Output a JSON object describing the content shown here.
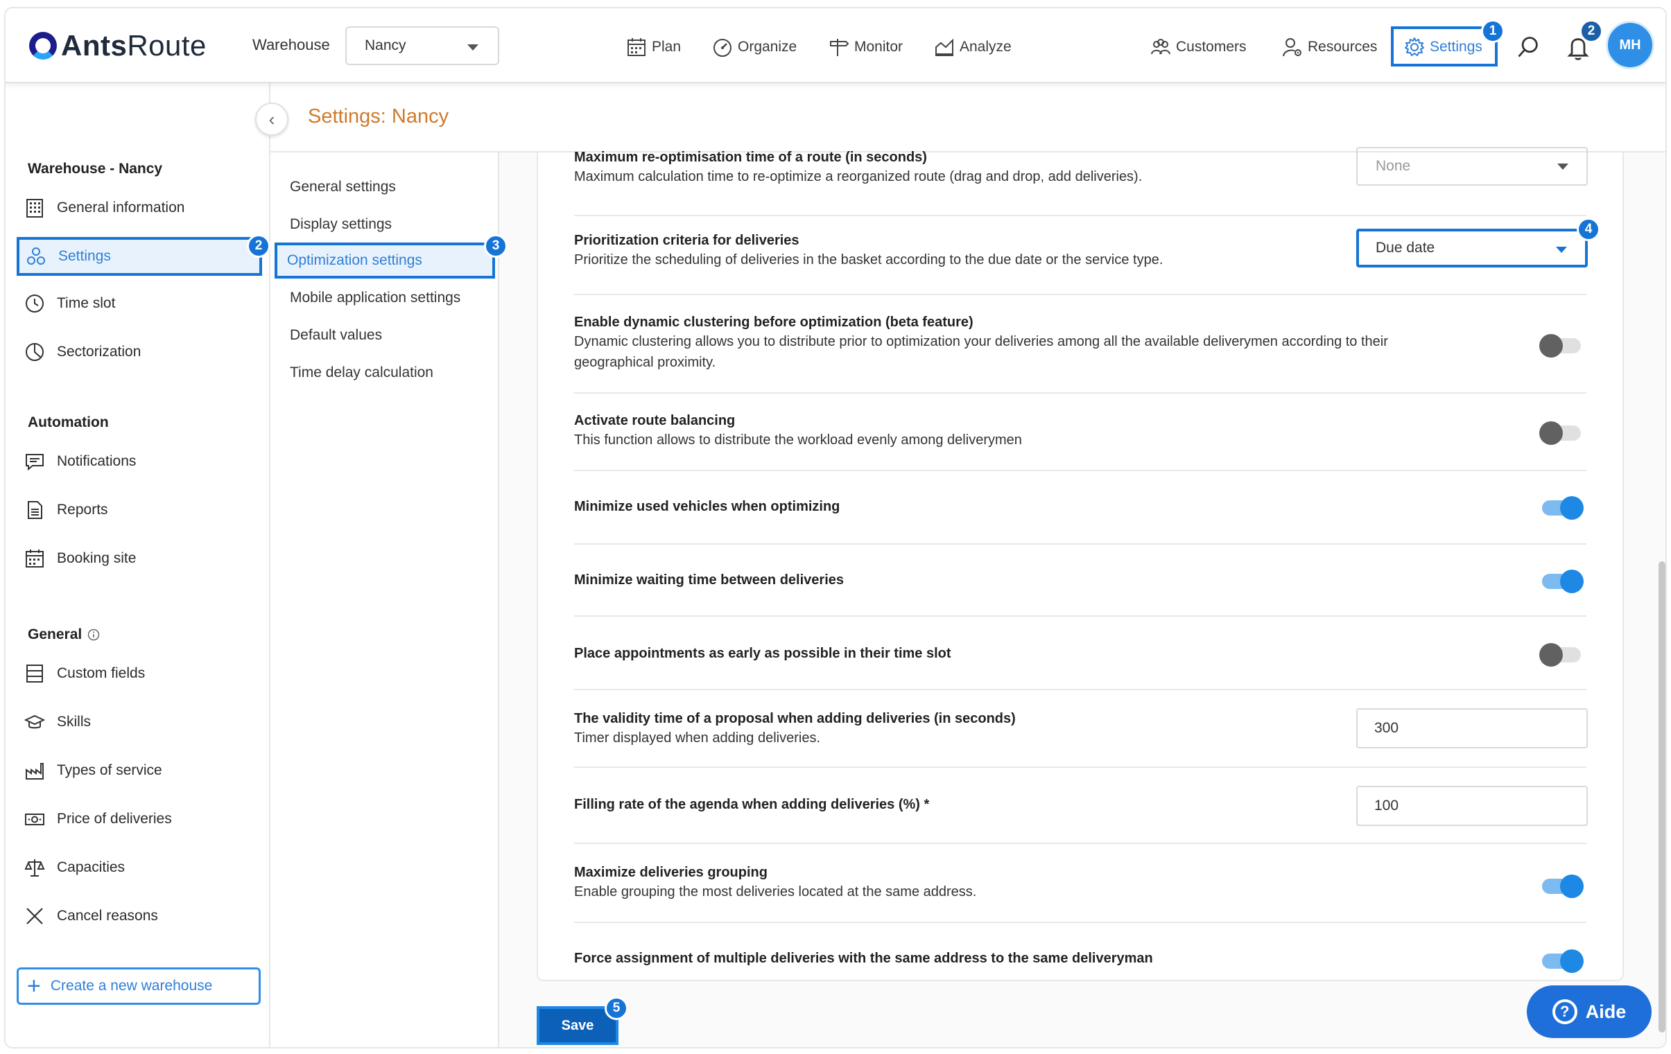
{
  "app": {
    "logo_bold": "Ants",
    "logo_rest": "Route",
    "warehouse_label": "Warehouse",
    "warehouse_value": "Nancy"
  },
  "nav": {
    "plan": "Plan",
    "organize": "Organize",
    "monitor": "Monitor",
    "analyze": "Analyze",
    "customers": "Customers",
    "resources": "Resources",
    "settings": "Settings",
    "notification_count": "2",
    "avatar_initials": "MH"
  },
  "steps": [
    "1",
    "2",
    "3",
    "4",
    "5"
  ],
  "sidebar": {
    "section_warehouse": "Warehouse - Nancy",
    "warehouse_items": [
      "General information",
      "Settings",
      "Time slot",
      "Sectorization"
    ],
    "section_automation": "Automation",
    "automation_items": [
      "Notifications",
      "Reports",
      "Booking site"
    ],
    "section_general": "General",
    "general_items": [
      "Custom fields",
      "Skills",
      "Types of service",
      "Price of deliveries",
      "Capacities",
      "Cancel reasons"
    ],
    "create_button": "Create a new warehouse"
  },
  "page": {
    "title": "Settings: Nancy"
  },
  "submenu": [
    "General settings",
    "Display settings",
    "Optimization settings",
    "Mobile application settings",
    "Default values",
    "Time delay calculation"
  ],
  "settings": {
    "reopt_title": "Maximum re-optimisation time of a route (in seconds)",
    "reopt_desc": "Maximum calculation time to re-optimize a reorganized route (drag and drop, add deliveries).",
    "reopt_value": "None",
    "prio_title": "Prioritization criteria for deliveries",
    "prio_desc": "Prioritize the scheduling of deliveries in the basket according to the due date or the service type.",
    "prio_value": "Due date",
    "cluster_title": "Enable dynamic clustering before optimization (beta feature)",
    "cluster_desc_1": "Dynamic clustering allows you to distribute prior to optimization your deliveries among all the available deliverymen according to their",
    "cluster_desc_2": "geographical proximity.",
    "balance_title": "Activate route balancing",
    "balance_desc": "This function allows to distribute the workload evenly among deliverymen",
    "min_vehicles_title": "Minimize used vehicles when optimizing",
    "min_waiting_title": "Minimize waiting time between deliveries",
    "early_title": "Place appointments as early as possible in their time slot",
    "validity_title": "The validity time of a proposal when adding deliveries (in seconds)",
    "validity_desc": "Timer displayed when adding deliveries.",
    "validity_value": "300",
    "filling_title": "Filling rate of the agenda when adding deliveries (%) *",
    "filling_value": "100",
    "grouping_title": "Maximize deliveries grouping",
    "grouping_desc": "Enable grouping the most deliveries located at the same address.",
    "force_title": "Force assignment of multiple deliveries with the same address to the same deliveryman",
    "toggles": {
      "cluster": false,
      "balance": false,
      "min_vehicles": true,
      "min_waiting": true,
      "early": false,
      "grouping": true,
      "force": true
    }
  },
  "actions": {
    "save": "Save",
    "help": "Aide"
  },
  "colors": {
    "accent": "#1574d6",
    "title": "#d07a2c",
    "toggle_on": "#1e88e5"
  }
}
